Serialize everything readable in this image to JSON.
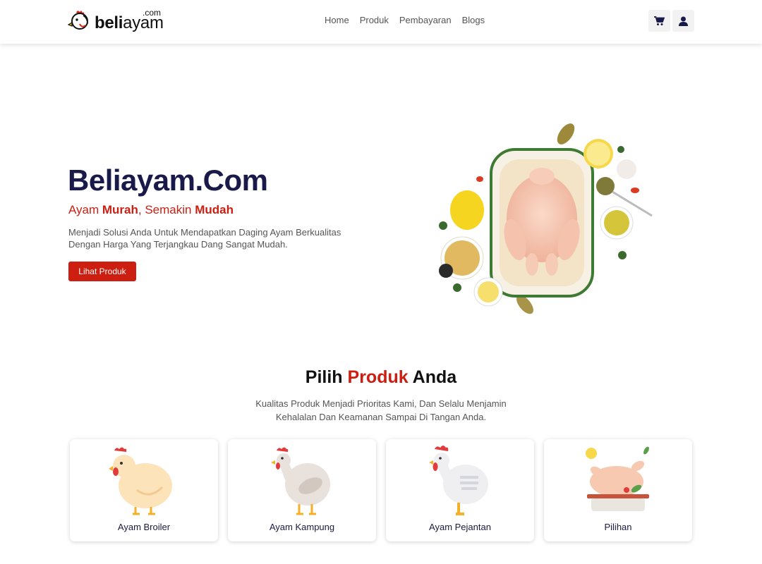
{
  "brand": {
    "name_bold": "beli",
    "name_light": "ayam",
    "suffix": ".com"
  },
  "nav": {
    "links": [
      "Home",
      "Produk",
      "Pembayaran",
      "Blogs"
    ]
  },
  "icons": {
    "cart": "cart-icon",
    "user": "user-icon"
  },
  "hero": {
    "title": "Beliayam.Com",
    "tagline_parts": [
      "Ayam ",
      "Murah",
      ", Semakin ",
      "Mudah"
    ],
    "description": "Menjadi Solusi Anda Untuk Mendapatkan Daging Ayam Berkualitas Dengan Harga Yang Terjangkau Dang Sangat Mudah.",
    "button_label": "Lihat Produk"
  },
  "products_section": {
    "title_parts": [
      "Pilih ",
      "Produk",
      " Anda"
    ],
    "description": "Kualitas Produk Menjadi Prioritas Kami, Dan Selalu Menjamin Kehalalan Dan Keamanan Sampai Di Tangan Anda.",
    "cards": [
      {
        "label": "Ayam Broiler",
        "icon": "broiler-chicken-icon"
      },
      {
        "label": "Ayam Kampung",
        "icon": "kampung-chicken-icon"
      },
      {
        "label": "Ayam Pejantan",
        "icon": "pejantan-chicken-icon"
      },
      {
        "label": "Pilihan",
        "icon": "roast-chicken-icon"
      }
    ]
  },
  "colors": {
    "accent": "#cc1f12",
    "navy": "#1a1a4a"
  }
}
